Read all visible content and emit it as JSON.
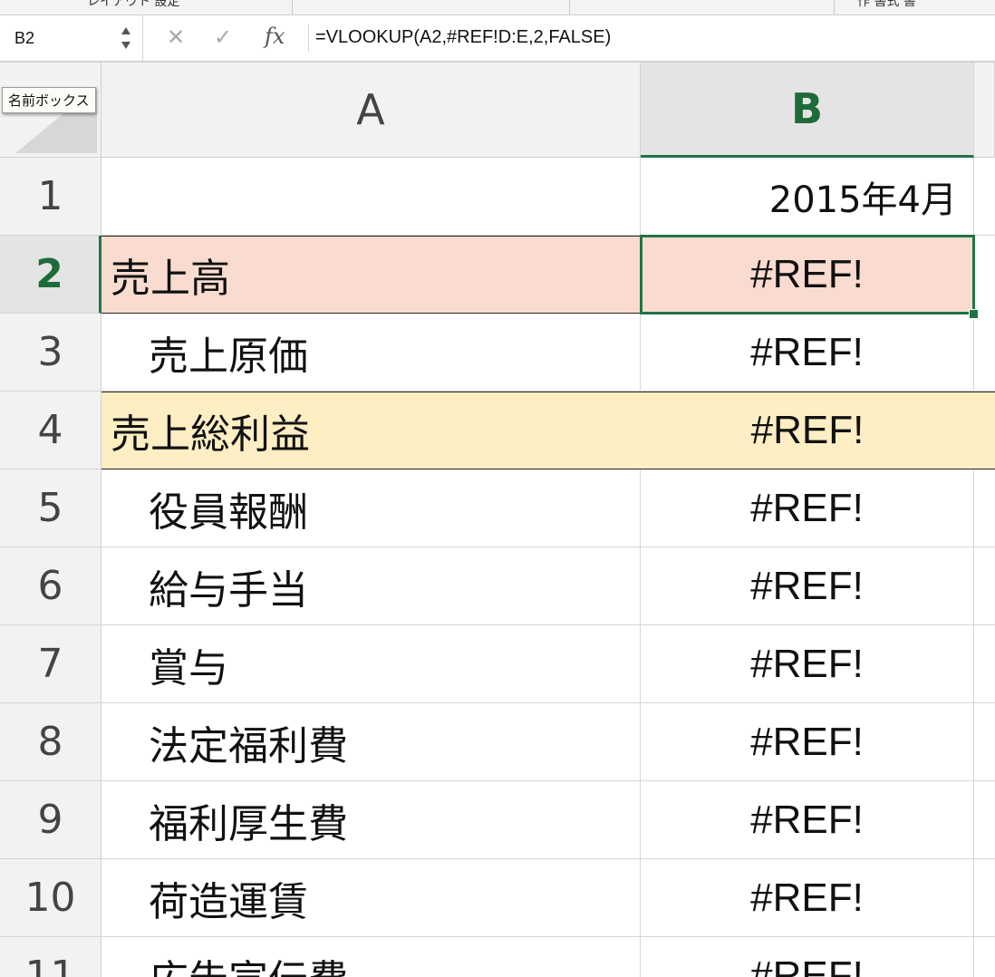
{
  "ribbon": {
    "left_fragment": "レイアウト  設定",
    "right_fragment": "作  書式      書"
  },
  "formula_bar": {
    "name_box": "B2",
    "cancel_icon": "✕",
    "enter_icon": "✓",
    "fx_label": "fx",
    "formula": "=VLOOKUP(A2,#REF!D:E,2,FALSE)"
  },
  "name_box_tooltip": "名前ボックス",
  "columns": [
    {
      "label": "A",
      "selected": false
    },
    {
      "label": "B",
      "selected": true
    }
  ],
  "rows": [
    {
      "num": "1",
      "a": "",
      "b": "2015年4月",
      "fill": "",
      "indent": false,
      "selected": false
    },
    {
      "num": "2",
      "a": "売上高",
      "b": "#REF!",
      "fill": "#f9dccf",
      "indent": false,
      "selected": true
    },
    {
      "num": "3",
      "a": "売上原価",
      "b": "#REF!",
      "fill": "",
      "indent": true,
      "selected": false
    },
    {
      "num": "4",
      "a": "売上総利益",
      "b": "#REF!",
      "fill": "#fdeec3",
      "indent": false,
      "selected": false
    },
    {
      "num": "5",
      "a": "役員報酬",
      "b": "#REF!",
      "fill": "",
      "indent": true,
      "selected": false
    },
    {
      "num": "6",
      "a": "給与手当",
      "b": "#REF!",
      "fill": "",
      "indent": true,
      "selected": false
    },
    {
      "num": "7",
      "a": "賞与",
      "b": "#REF!",
      "fill": "",
      "indent": true,
      "selected": false
    },
    {
      "num": "8",
      "a": "法定福利費",
      "b": "#REF!",
      "fill": "",
      "indent": true,
      "selected": false
    },
    {
      "num": "9",
      "a": "福利厚生費",
      "b": "#REF!",
      "fill": "",
      "indent": true,
      "selected": false
    },
    {
      "num": "10",
      "a": "荷造運賃",
      "b": "#REF!",
      "fill": "",
      "indent": true,
      "selected": false
    },
    {
      "num": "11",
      "a": "広告宣伝費",
      "b": "#REF!",
      "fill": "",
      "indent": true,
      "selected": false
    }
  ],
  "colors": {
    "accent": "#217346",
    "header_bg": "#f2f2f2"
  }
}
